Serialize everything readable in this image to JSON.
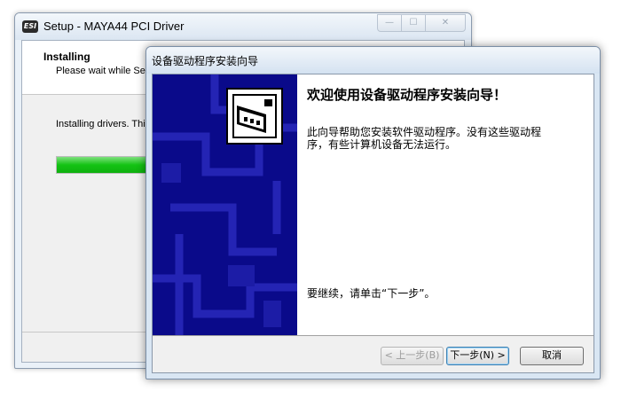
{
  "setup_window": {
    "title": "Setup - MAYA44 PCI Driver",
    "app_icon": "ESI",
    "caption_buttons": {
      "minimize": "—",
      "maximize": "☐",
      "close": "✕"
    },
    "heading": "Installing",
    "subheading": "Please wait while Set",
    "status": "Installing drivers. Thi",
    "progress_fraction": 0.24
  },
  "wizard": {
    "title": "设备驱动程序安装向导",
    "heading": "欢迎使用设备驱动程序安装向导！",
    "description": "此向导帮助您安装软件驱动程序。没有这些驱动程序，有些计算机设备无法运行。",
    "continue_text": "要继续，请单击“下一步”。",
    "buttons": {
      "back": "< 上一步(B)",
      "next": "下一步(N) >",
      "cancel": "取消"
    },
    "colors": {
      "sidebar": "#0a0a8a",
      "sidebar_pattern": "#2222b8"
    }
  }
}
